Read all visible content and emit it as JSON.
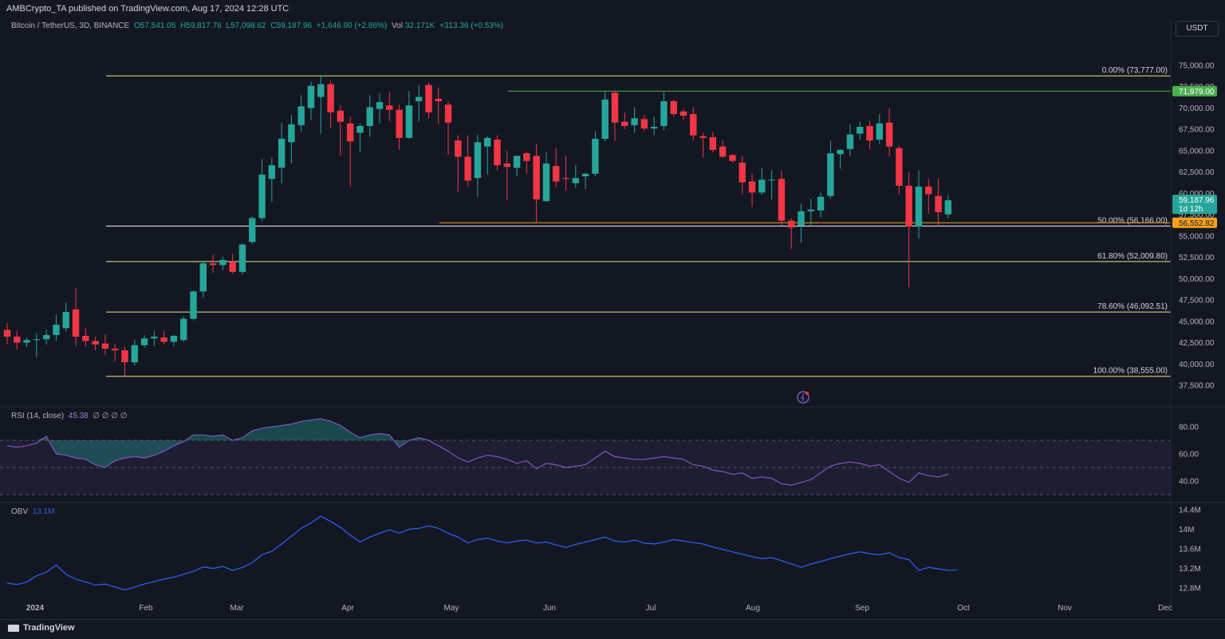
{
  "header": {
    "publisher": "AMBCrypto_TA published on TradingView.com, Aug 17, 2024 12:28 UTC",
    "symbol": "Bitcoin / TetherUS, 3D, BINANCE",
    "open": "O57,541.05",
    "high": "H59,817.76",
    "low": "L57,098.62",
    "close": "C59,187.96",
    "change": "+1,646.90 (+2.86%)",
    "vol_label": "Vol",
    "vol": "32.171K",
    "vol_change": "+313.36 (+0.53%)",
    "currency": "USDT"
  },
  "colors": {
    "background": "#131722",
    "up": "#26a69a",
    "down": "#f23645",
    "fib": "#e6e68a",
    "fib_bold": "#f5f5f5",
    "green_line": "#4caf50",
    "orange_line": "#f7a21b",
    "rsi": "#7e57c2",
    "obv": "#2962ff"
  },
  "chart_data": {
    "type": "candlestick",
    "timeframe": "3D",
    "y_ticks": [
      "75,000.00",
      "72,500.00",
      "70,000.00",
      "67,500.00",
      "65,000.00",
      "62,500.00",
      "60,000.00",
      "57,500.00",
      "55,000.00",
      "52,500.00",
      "50,000.00",
      "47,500.00",
      "45,000.00",
      "42,500.00",
      "40,000.00",
      "37,500.00"
    ],
    "x_ticks": [
      "2024",
      "Feb",
      "Mar",
      "Apr",
      "May",
      "Jun",
      "Jul",
      "Aug",
      "Sep",
      "Oct",
      "Nov",
      "Dec"
    ],
    "candles": [
      {
        "o": 44000,
        "h": 44800,
        "l": 42300,
        "c": 43200
      },
      {
        "o": 43200,
        "h": 43900,
        "l": 41700,
        "c": 42500
      },
      {
        "o": 42500,
        "h": 43100,
        "l": 42000,
        "c": 42800
      },
      {
        "o": 42800,
        "h": 43600,
        "l": 40800,
        "c": 42900
      },
      {
        "o": 42900,
        "h": 44000,
        "l": 42300,
        "c": 43400
      },
      {
        "o": 43400,
        "h": 45800,
        "l": 42700,
        "c": 44600
      },
      {
        "o": 44200,
        "h": 47200,
        "l": 43800,
        "c": 46100
      },
      {
        "o": 46400,
        "h": 48900,
        "l": 42100,
        "c": 43200
      },
      {
        "o": 43300,
        "h": 44200,
        "l": 42000,
        "c": 42700
      },
      {
        "o": 42700,
        "h": 43200,
        "l": 41600,
        "c": 42300
      },
      {
        "o": 42400,
        "h": 43500,
        "l": 41100,
        "c": 41800
      },
      {
        "o": 41800,
        "h": 42400,
        "l": 40300,
        "c": 41600
      },
      {
        "o": 41600,
        "h": 42000,
        "l": 38555,
        "c": 40200
      },
      {
        "o": 40200,
        "h": 42900,
        "l": 39800,
        "c": 42200
      },
      {
        "o": 42200,
        "h": 43400,
        "l": 41900,
        "c": 43000
      },
      {
        "o": 43000,
        "h": 43900,
        "l": 42100,
        "c": 43200
      },
      {
        "o": 43100,
        "h": 43900,
        "l": 42300,
        "c": 42600
      },
      {
        "o": 42600,
        "h": 43400,
        "l": 42100,
        "c": 43300
      },
      {
        "o": 42800,
        "h": 45600,
        "l": 42600,
        "c": 45300
      },
      {
        "o": 45300,
        "h": 48600,
        "l": 45100,
        "c": 48500
      },
      {
        "o": 48500,
        "h": 52000,
        "l": 47800,
        "c": 51800
      },
      {
        "o": 51800,
        "h": 52800,
        "l": 50700,
        "c": 51600
      },
      {
        "o": 51600,
        "h": 52600,
        "l": 51000,
        "c": 52200
      },
      {
        "o": 52000,
        "h": 52900,
        "l": 50600,
        "c": 50800
      },
      {
        "o": 50800,
        "h": 54100,
        "l": 50500,
        "c": 54000
      },
      {
        "o": 54300,
        "h": 57300,
        "l": 54100,
        "c": 57100
      },
      {
        "o": 57100,
        "h": 64000,
        "l": 56700,
        "c": 62200
      },
      {
        "o": 61700,
        "h": 64200,
        "l": 59000,
        "c": 63300
      },
      {
        "o": 63000,
        "h": 68300,
        "l": 61200,
        "c": 66400
      },
      {
        "o": 66000,
        "h": 69200,
        "l": 63500,
        "c": 68100
      },
      {
        "o": 68000,
        "h": 71500,
        "l": 67200,
        "c": 70200
      },
      {
        "o": 70000,
        "h": 73100,
        "l": 68600,
        "c": 72600
      },
      {
        "o": 71300,
        "h": 73777,
        "l": 67000,
        "c": 72800
      },
      {
        "o": 72800,
        "h": 73200,
        "l": 67700,
        "c": 69500
      },
      {
        "o": 69700,
        "h": 70400,
        "l": 64400,
        "c": 68400
      },
      {
        "o": 68200,
        "h": 69000,
        "l": 60800,
        "c": 66100
      },
      {
        "o": 67100,
        "h": 68200,
        "l": 64800,
        "c": 67900
      },
      {
        "o": 67900,
        "h": 71500,
        "l": 66600,
        "c": 70100
      },
      {
        "o": 69900,
        "h": 71700,
        "l": 68200,
        "c": 70700
      },
      {
        "o": 70300,
        "h": 71900,
        "l": 68500,
        "c": 69800
      },
      {
        "o": 69800,
        "h": 70400,
        "l": 65100,
        "c": 66500
      },
      {
        "o": 66500,
        "h": 72000,
        "l": 66400,
        "c": 70300
      },
      {
        "o": 70800,
        "h": 72700,
        "l": 68400,
        "c": 71300
      },
      {
        "o": 72700,
        "h": 73000,
        "l": 68800,
        "c": 69500
      },
      {
        "o": 71100,
        "h": 72400,
        "l": 68100,
        "c": 70800
      },
      {
        "o": 70400,
        "h": 70800,
        "l": 64500,
        "c": 68300
      },
      {
        "o": 66200,
        "h": 66800,
        "l": 60200,
        "c": 64300
      },
      {
        "o": 64300,
        "h": 66800,
        "l": 60800,
        "c": 61500
      },
      {
        "o": 61800,
        "h": 66900,
        "l": 59600,
        "c": 66000
      },
      {
        "o": 65500,
        "h": 66700,
        "l": 62200,
        "c": 66500
      },
      {
        "o": 66300,
        "h": 66800,
        "l": 62700,
        "c": 63300
      },
      {
        "o": 63500,
        "h": 65000,
        "l": 59200,
        "c": 63100
      },
      {
        "o": 63000,
        "h": 64400,
        "l": 62000,
        "c": 64400
      },
      {
        "o": 64700,
        "h": 64900,
        "l": 62300,
        "c": 63800
      },
      {
        "o": 64400,
        "h": 65800,
        "l": 56552,
        "c": 59300
      },
      {
        "o": 59100,
        "h": 64800,
        "l": 59000,
        "c": 63500
      },
      {
        "o": 63200,
        "h": 65300,
        "l": 60700,
        "c": 61400
      },
      {
        "o": 61800,
        "h": 64400,
        "l": 60300,
        "c": 61700
      },
      {
        "o": 61200,
        "h": 63300,
        "l": 60600,
        "c": 61800
      },
      {
        "o": 62000,
        "h": 62400,
        "l": 60500,
        "c": 62300
      },
      {
        "o": 62300,
        "h": 67300,
        "l": 62000,
        "c": 66400
      },
      {
        "o": 66400,
        "h": 71979,
        "l": 66100,
        "c": 71000
      },
      {
        "o": 71800,
        "h": 71979,
        "l": 66200,
        "c": 68300
      },
      {
        "o": 68400,
        "h": 69500,
        "l": 67500,
        "c": 67900
      },
      {
        "o": 68000,
        "h": 70100,
        "l": 67100,
        "c": 68800
      },
      {
        "o": 68700,
        "h": 69200,
        "l": 67300,
        "c": 67600
      },
      {
        "o": 67600,
        "h": 69000,
        "l": 66800,
        "c": 67800
      },
      {
        "o": 67900,
        "h": 71900,
        "l": 67400,
        "c": 70800
      },
      {
        "o": 70800,
        "h": 71000,
        "l": 69000,
        "c": 69300
      },
      {
        "o": 69600,
        "h": 69900,
        "l": 68600,
        "c": 69100
      },
      {
        "o": 69300,
        "h": 70100,
        "l": 66200,
        "c": 66800
      },
      {
        "o": 66700,
        "h": 67100,
        "l": 64200,
        "c": 66500
      },
      {
        "o": 66600,
        "h": 67200,
        "l": 64800,
        "c": 65100
      },
      {
        "o": 65500,
        "h": 66200,
        "l": 64200,
        "c": 64300
      },
      {
        "o": 64500,
        "h": 64600,
        "l": 63600,
        "c": 63800
      },
      {
        "o": 63600,
        "h": 64400,
        "l": 59900,
        "c": 61300
      },
      {
        "o": 61400,
        "h": 62300,
        "l": 58400,
        "c": 60100
      },
      {
        "o": 60100,
        "h": 63000,
        "l": 59800,
        "c": 61600
      },
      {
        "o": 61600,
        "h": 62700,
        "l": 59300,
        "c": 61600
      },
      {
        "o": 61700,
        "h": 62700,
        "l": 56200,
        "c": 56800
      },
      {
        "o": 56800,
        "h": 57100,
        "l": 53500,
        "c": 56000
      },
      {
        "o": 56200,
        "h": 58800,
        "l": 54200,
        "c": 57900
      },
      {
        "o": 57900,
        "h": 59400,
        "l": 56200,
        "c": 58100
      },
      {
        "o": 58000,
        "h": 60100,
        "l": 57200,
        "c": 59600
      },
      {
        "o": 59700,
        "h": 66200,
        "l": 59400,
        "c": 64700
      },
      {
        "o": 64600,
        "h": 65200,
        "l": 62900,
        "c": 65100
      },
      {
        "o": 65200,
        "h": 68100,
        "l": 64400,
        "c": 66900
      },
      {
        "o": 67000,
        "h": 68400,
        "l": 66300,
        "c": 67800
      },
      {
        "o": 67900,
        "h": 68500,
        "l": 65200,
        "c": 66200
      },
      {
        "o": 66300,
        "h": 69300,
        "l": 65800,
        "c": 68200
      },
      {
        "o": 68300,
        "h": 70000,
        "l": 64300,
        "c": 65500
      },
      {
        "o": 65300,
        "h": 65600,
        "l": 59900,
        "c": 60900
      },
      {
        "o": 60900,
        "h": 62500,
        "l": 49000,
        "c": 56100
      },
      {
        "o": 56100,
        "h": 62700,
        "l": 54700,
        "c": 60800
      },
      {
        "o": 60800,
        "h": 61700,
        "l": 57600,
        "c": 59900
      },
      {
        "o": 59700,
        "h": 61800,
        "l": 56100,
        "c": 57800
      },
      {
        "o": 57541.05,
        "h": 59817.76,
        "l": 57098.62,
        "c": 59187.96
      }
    ],
    "fib_levels": [
      {
        "label": "0.00% (73,777.00)",
        "value": 73777
      },
      {
        "label": "50.00% (56,166.00)",
        "value": 56166
      },
      {
        "label": "61.80% (52,009.80)",
        "value": 52009.8
      },
      {
        "label": "78.60% (46,092.51)",
        "value": 46092.51
      },
      {
        "label": "100.00% (38,555.00)",
        "value": 38555
      }
    ],
    "price_tags": [
      {
        "label": "71,979.00",
        "value": 71979,
        "kind": "green"
      },
      {
        "label": "59,187.96",
        "sub": "1d 12h",
        "value": 59187.96,
        "kind": "current"
      },
      {
        "label": "56,552.82",
        "value": 56552.82,
        "kind": "orange"
      }
    ],
    "rsi": {
      "label": "RSI (14, close)",
      "value": "45.38",
      "extra": "∅ ∅ ∅ ∅",
      "levels": [
        80,
        60,
        40
      ],
      "level_labels": [
        "80.00",
        "60.00",
        "40.00"
      ],
      "overbought": 70,
      "oversold": 30,
      "values": [
        66,
        65,
        66,
        68,
        73,
        60,
        59,
        57,
        56,
        52,
        50,
        55,
        57,
        58,
        57,
        59,
        62,
        66,
        69,
        74,
        74,
        73,
        74,
        70,
        72,
        77,
        79,
        80,
        81,
        82,
        84,
        85,
        86,
        84,
        81,
        76,
        72,
        74,
        75,
        74,
        65,
        70,
        72,
        70,
        66,
        62,
        57,
        54,
        57,
        59,
        58,
        56,
        53,
        55,
        49,
        53,
        52,
        50,
        51,
        52,
        57,
        62,
        58,
        57,
        56,
        56,
        57,
        58,
        57,
        56,
        52,
        51,
        48,
        47,
        45,
        46,
        42,
        43,
        42,
        38,
        37,
        39,
        41,
        46,
        51,
        53,
        54,
        53,
        51,
        52,
        47,
        42,
        39,
        46,
        44,
        43,
        45
      ]
    },
    "obv": {
      "label": "OBV",
      "value": "13.1M",
      "y_ticks": [
        "14.4M",
        "14M",
        "13.6M",
        "13.2M",
        "12.8M"
      ],
      "values": [
        12.9,
        12.87,
        12.92,
        13.05,
        13.12,
        13.27,
        13.08,
        12.98,
        12.92,
        12.86,
        12.88,
        12.82,
        12.76,
        12.82,
        12.88,
        12.93,
        12.98,
        13.02,
        13.08,
        13.14,
        13.23,
        13.2,
        13.24,
        13.16,
        13.22,
        13.32,
        13.48,
        13.55,
        13.7,
        13.86,
        14.02,
        14.13,
        14.27,
        14.16,
        14.04,
        13.88,
        13.74,
        13.84,
        13.92,
        13.99,
        13.92,
        14.0,
        14.02,
        14.07,
        14.02,
        13.92,
        13.84,
        13.72,
        13.79,
        13.82,
        13.76,
        13.72,
        13.76,
        13.78,
        13.72,
        13.74,
        13.68,
        13.63,
        13.69,
        13.74,
        13.79,
        13.84,
        13.76,
        13.74,
        13.78,
        13.72,
        13.7,
        13.74,
        13.79,
        13.76,
        13.73,
        13.7,
        13.64,
        13.59,
        13.54,
        13.49,
        13.44,
        13.4,
        13.42,
        13.36,
        13.29,
        13.22,
        13.29,
        13.34,
        13.4,
        13.45,
        13.5,
        13.54,
        13.5,
        13.48,
        13.52,
        13.42,
        13.38,
        13.16,
        13.22,
        13.19,
        13.16,
        13.17
      ]
    }
  },
  "footer": {
    "brand": "TradingView"
  }
}
